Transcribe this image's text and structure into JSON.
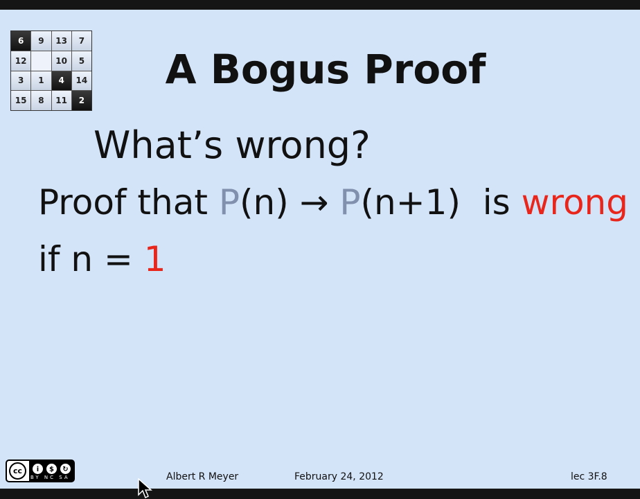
{
  "slide": {
    "title": "A Bogus Proof",
    "question": "What’s wrong?",
    "line1": {
      "text1": "Proof that ",
      "pred1": "P",
      "arg1": "(n)",
      "arrow": " → ",
      "pred2": "P",
      "arg2": "(n+1)",
      "text2": "  is ",
      "emph": "wrong"
    },
    "line2": {
      "text1": "if n = ",
      "emph": "1"
    }
  },
  "puzzle": {
    "tiles": [
      "6",
      "9",
      "13",
      "7",
      "12",
      "",
      "10",
      "5",
      "3",
      "1",
      "4",
      "14",
      "15",
      "8",
      "11",
      "2"
    ],
    "dark_tiles": [
      0,
      10,
      15
    ]
  },
  "footer": {
    "author": "Albert R Meyer",
    "date": "February 24, 2012",
    "lecture": "lec 3F.8"
  },
  "license": {
    "logo_icon": "creative-commons-by-nc-sa-icon",
    "text": "BY NC SA"
  },
  "colors": {
    "background": "#d3e3f8",
    "predicate": "#8090ad",
    "emphasis": "#e8261c"
  }
}
